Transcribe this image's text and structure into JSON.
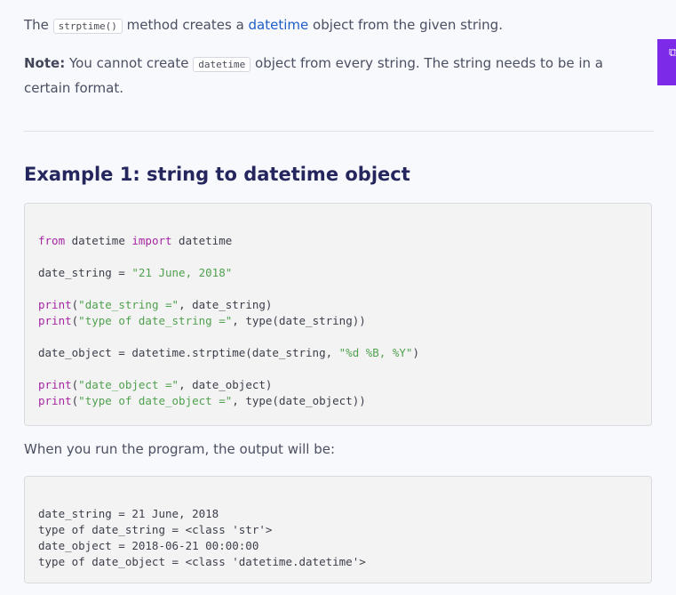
{
  "intro": {
    "before": "The ",
    "code": "strptime()",
    "mid": " method creates a ",
    "link": "datetime",
    "after": " object from the given string."
  },
  "note": {
    "label": "Note:",
    "before": " You cannot create ",
    "code": "datetime",
    "after": " object from every string. The string needs to be in a certain format."
  },
  "heading": "Example 1: string to datetime object",
  "code_example": [
    [
      {
        "t": "from",
        "c": "kw"
      },
      {
        "t": " datetime "
      },
      {
        "t": "import",
        "c": "kw"
      },
      {
        "t": " datetime"
      }
    ],
    [],
    [
      {
        "t": "date_string = "
      },
      {
        "t": "\"21 June, 2018\"",
        "c": "str"
      }
    ],
    [],
    [
      {
        "t": "print",
        "c": "fn"
      },
      {
        "t": "("
      },
      {
        "t": "\"date_string =\"",
        "c": "str"
      },
      {
        "t": ", date_string)"
      }
    ],
    [
      {
        "t": "print",
        "c": "fn"
      },
      {
        "t": "("
      },
      {
        "t": "\"type of date_string =\"",
        "c": "str"
      },
      {
        "t": ", type(date_string))"
      }
    ],
    [],
    [
      {
        "t": "date_object = datetime.strptime(date_string, "
      },
      {
        "t": "\"%d %B, %Y\"",
        "c": "str"
      },
      {
        "t": ")"
      }
    ],
    [],
    [
      {
        "t": "print",
        "c": "fn"
      },
      {
        "t": "("
      },
      {
        "t": "\"date_object =\"",
        "c": "str"
      },
      {
        "t": ", date_object)"
      }
    ],
    [
      {
        "t": "print",
        "c": "fn"
      },
      {
        "t": "("
      },
      {
        "t": "\"type of date_object =\"",
        "c": "str"
      },
      {
        "t": ", type(date_object))"
      }
    ]
  ],
  "output_intro": "When you run the program, the output will be:",
  "output_lines": [
    "date_string = 21 June, 2018",
    "type of date_string = <class 'str'>",
    "date_object = 2018-06-21 00:00:00",
    "type of date_object = <class 'datetime.datetime'>"
  ],
  "side_tab": {
    "icon": "copy-icon",
    "glyph": "⧉",
    "color": "#7d2ae8"
  }
}
